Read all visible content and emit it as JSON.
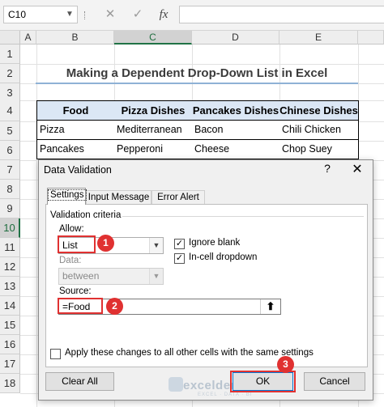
{
  "formula_bar": {
    "name_box": "C10",
    "cancel_icon": "✕",
    "enter_icon": "✓",
    "fx_label": "fx",
    "formula_value": ""
  },
  "columns": [
    "A",
    "B",
    "C",
    "D",
    "E"
  ],
  "selected_column": "C",
  "rows": [
    "1",
    "2",
    "3",
    "4",
    "5",
    "6",
    "7",
    "8",
    "9",
    "10",
    "11",
    "12",
    "13",
    "14",
    "15",
    "16",
    "17",
    "18"
  ],
  "selected_row": "10",
  "sheet": {
    "title": "Making a Dependent Drop-Down List in Excel",
    "table": {
      "headers": [
        "Food",
        "Pizza Dishes",
        "Pancakes Dishes",
        "Chinese Dishes"
      ],
      "rows": [
        [
          "Pizza",
          "Mediterranean",
          "Bacon",
          "Chili Chicken"
        ],
        [
          "Pancakes",
          "Pepperoni",
          "Cheese",
          "Chop Suey"
        ]
      ]
    }
  },
  "dialog": {
    "title": "Data Validation",
    "help": "?",
    "close": "✕",
    "tabs": [
      "Settings",
      "Input Message",
      "Error Alert"
    ],
    "active_tab": "Settings",
    "validation_criteria": "Validation criteria",
    "allow_label": "Allow:",
    "allow_value": "List",
    "data_label": "Data:",
    "data_value": "between",
    "ignore_blank": {
      "label": "Ignore blank",
      "checked": true
    },
    "in_cell_dropdown": {
      "label": "In-cell dropdown",
      "checked": true
    },
    "source_label": "Source:",
    "source_value": "=Food",
    "apply_all": {
      "label": "Apply these changes to all other cells with the same settings",
      "checked": false
    },
    "clear_all": "Clear All",
    "ok": "OK",
    "cancel": "Cancel"
  },
  "step_badges": [
    "1",
    "2",
    "3"
  ],
  "watermark": {
    "name": "exceldemy",
    "tagline": "EXCEL · DATA · BI"
  },
  "colors": {
    "accent_green": "#217346",
    "header_fill": "#dbe7f5",
    "highlight_red": "#e03131"
  }
}
